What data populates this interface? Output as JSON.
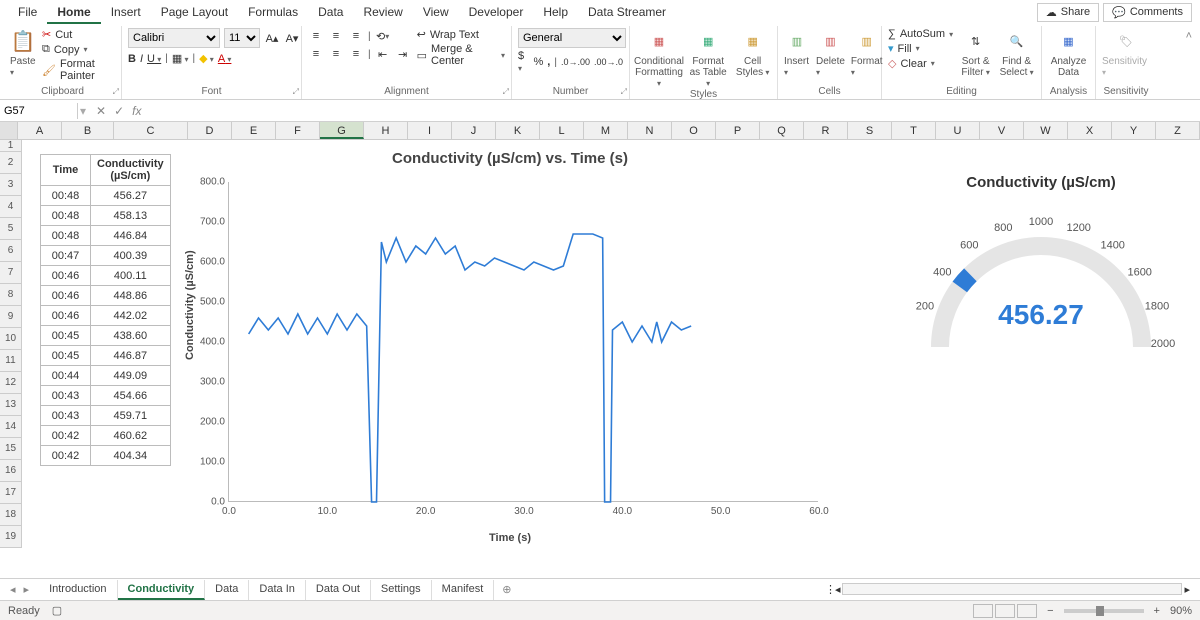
{
  "menu": {
    "tabs": [
      "File",
      "Home",
      "Insert",
      "Page Layout",
      "Formulas",
      "Data",
      "Review",
      "View",
      "Developer",
      "Help",
      "Data Streamer"
    ],
    "active": "Home",
    "share": "Share",
    "comments": "Comments"
  },
  "ribbon": {
    "clipboard": {
      "label": "Clipboard",
      "paste": "Paste",
      "cut": "Cut",
      "copy": "Copy",
      "format_painter": "Format Painter"
    },
    "font": {
      "label": "Font",
      "name": "Calibri",
      "size": "11"
    },
    "alignment": {
      "label": "Alignment",
      "wrap": "Wrap Text",
      "merge": "Merge & Center"
    },
    "number": {
      "label": "Number",
      "format": "General"
    },
    "styles": {
      "label": "Styles",
      "conditional": "Conditional Formatting",
      "table": "Format as Table",
      "cell": "Cell Styles"
    },
    "cells": {
      "label": "Cells",
      "insert": "Insert",
      "delete": "Delete",
      "format": "Format"
    },
    "editing": {
      "label": "Editing",
      "autosum": "AutoSum",
      "fill": "Fill",
      "clear": "Clear",
      "sort": "Sort & Filter",
      "find": "Find & Select"
    },
    "analysis": {
      "label": "Analysis",
      "analyze": "Analyze Data"
    },
    "sensitivity": {
      "label": "Sensitivity",
      "btn": "Sensitivity"
    }
  },
  "formula_bar": {
    "cell_ref": "G57"
  },
  "columns": [
    "A",
    "B",
    "C",
    "D",
    "E",
    "F",
    "G",
    "H",
    "I",
    "J",
    "K",
    "L",
    "M",
    "N",
    "O",
    "P",
    "Q",
    "R",
    "S",
    "T",
    "U",
    "V",
    "W",
    "X",
    "Y",
    "Z"
  ],
  "selected_column": "G",
  "row_numbers": [
    1,
    2,
    3,
    4,
    5,
    6,
    7,
    8,
    9,
    10,
    11,
    12,
    13,
    14,
    15,
    16,
    17,
    18,
    19
  ],
  "table": {
    "headers": {
      "time": "Time",
      "cond": "Conductivity (µS/cm)"
    },
    "rows": [
      {
        "t": "00:48",
        "v": "456.27"
      },
      {
        "t": "00:48",
        "v": "458.13"
      },
      {
        "t": "00:48",
        "v": "446.84"
      },
      {
        "t": "00:47",
        "v": "400.39"
      },
      {
        "t": "00:46",
        "v": "400.11"
      },
      {
        "t": "00:46",
        "v": "448.86"
      },
      {
        "t": "00:46",
        "v": "442.02"
      },
      {
        "t": "00:45",
        "v": "438.60"
      },
      {
        "t": "00:45",
        "v": "446.87"
      },
      {
        "t": "00:44",
        "v": "449.09"
      },
      {
        "t": "00:43",
        "v": "454.66"
      },
      {
        "t": "00:43",
        "v": "459.71"
      },
      {
        "t": "00:42",
        "v": "460.62"
      },
      {
        "t": "00:42",
        "v": "404.34"
      }
    ]
  },
  "chart_data": {
    "type": "line",
    "title": "Conductivity (µS/cm) vs. Time (s)",
    "xlabel": "Time (s)",
    "ylabel": "Conductivity (µS/cm)",
    "xlim": [
      0,
      60
    ],
    "ylim": [
      0,
      800
    ],
    "y_ticks": [
      "0.0",
      "100.0",
      "200.0",
      "300.0",
      "400.0",
      "500.0",
      "600.0",
      "700.0",
      "800.0"
    ],
    "x_ticks": [
      "0.0",
      "10.0",
      "20.0",
      "30.0",
      "40.0",
      "50.0",
      "60.0"
    ],
    "series": [
      {
        "name": "Conductivity",
        "color": "#2e7cd6",
        "x": [
          2,
          3,
          4,
          5,
          6,
          7,
          8,
          9,
          10,
          11,
          12,
          13,
          14,
          14.5,
          15,
          15.5,
          16,
          17,
          18,
          19,
          20,
          21,
          22,
          23,
          24,
          25,
          26,
          27,
          28,
          29,
          30,
          31,
          32,
          33,
          34,
          35,
          36,
          36.5,
          37,
          38,
          38.2,
          38.8,
          39,
          40,
          41,
          42,
          43,
          43.5,
          44,
          45,
          46,
          47
        ],
        "y": [
          420,
          460,
          430,
          460,
          420,
          470,
          420,
          460,
          420,
          470,
          430,
          470,
          440,
          0,
          0,
          650,
          600,
          660,
          600,
          640,
          620,
          660,
          620,
          640,
          580,
          600,
          590,
          610,
          600,
          590,
          580,
          600,
          590,
          580,
          590,
          670,
          670,
          670,
          670,
          660,
          0,
          0,
          430,
          450,
          400,
          440,
          400,
          450,
          400,
          450,
          430,
          440
        ]
      }
    ]
  },
  "gauge": {
    "title": "Conductivity (µS/cm)",
    "value": "456.27",
    "min": 0,
    "max": 2000,
    "ticks": [
      "200",
      "400",
      "600",
      "800",
      "1000",
      "1200",
      "1400",
      "1600",
      "1800",
      "2000"
    ]
  },
  "sheets": {
    "tabs": [
      "Introduction",
      "Conductivity",
      "Data",
      "Data In",
      "Data Out",
      "Settings",
      "Manifest"
    ],
    "active": "Conductivity"
  },
  "status": {
    "ready": "Ready",
    "zoom": "90%"
  }
}
